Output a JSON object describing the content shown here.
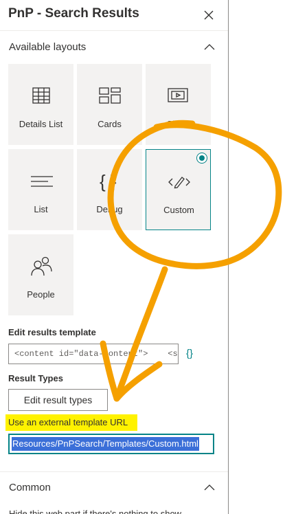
{
  "header": {
    "title": "PnP - Search Results",
    "close_icon": "close-icon"
  },
  "layouts_section": {
    "title": "Available layouts",
    "tiles": [
      {
        "label": "Details List",
        "icon": "table-icon"
      },
      {
        "label": "Cards",
        "icon": "cards-icon"
      },
      {
        "label": "Slider",
        "icon": "slider-icon"
      },
      {
        "label": "List",
        "icon": "list-icon"
      },
      {
        "label": "Debug",
        "icon": "curly-braces-icon"
      },
      {
        "label": "Custom",
        "icon": "edit-code-icon",
        "selected": true
      },
      {
        "label": "People",
        "icon": "people-icon"
      }
    ]
  },
  "template": {
    "label": "Edit results template",
    "value": "<content id=\"data-content\">    <st...",
    "braces_icon": "{}"
  },
  "result_types": {
    "label": "Result Types",
    "button_label": "Edit result types"
  },
  "external_template": {
    "label": "Use an external template URL",
    "value": "Resources/PnPSearch/Templates/Custom.html"
  },
  "common_section": {
    "title": "Common",
    "cut_text": "Hide this web part if there's nothing to show"
  },
  "colors": {
    "accent": "#038387",
    "highlight": "#fff200",
    "annotation": "#f5a000",
    "selection": "#3b6fd8"
  }
}
